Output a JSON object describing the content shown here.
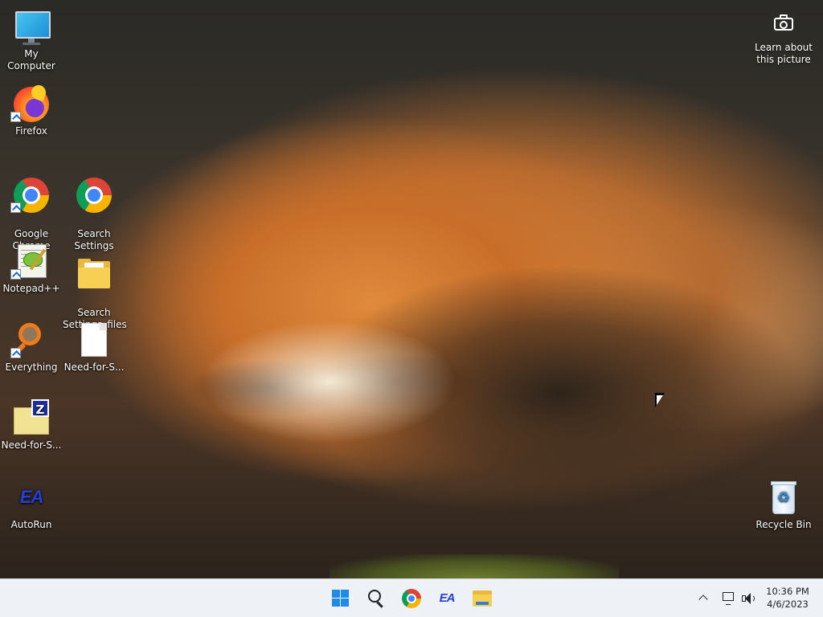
{
  "desktop": {
    "icons": [
      {
        "label": "My Computer",
        "icon": "monitor-icon"
      },
      {
        "label": "Firefox",
        "icon": "firefox-icon",
        "shortcut": true
      },
      {
        "label": "Google\nChrome",
        "icon": "chrome-icon",
        "shortcut": true
      },
      {
        "label": "Search\nSettings",
        "icon": "chrome-icon"
      },
      {
        "label": "Notepad++",
        "icon": "notepadpp-icon",
        "shortcut": true
      },
      {
        "label": "Search\nSettings_files",
        "icon": "folder-icon"
      },
      {
        "label": "Everything",
        "icon": "everything-icon",
        "shortcut": true
      },
      {
        "label": "Need-for-S...",
        "icon": "file-icon"
      },
      {
        "label": "Need-for-S...",
        "icon": "zip-folder-icon"
      },
      {
        "label": "AutoRun",
        "icon": "ea-icon"
      },
      {
        "label": "Recycle Bin",
        "icon": "recycle-bin-icon"
      }
    ],
    "learn_about": {
      "line1": "Learn about",
      "line2": "this picture",
      "icon": "camera-icon"
    }
  },
  "taskbar": {
    "pinned": [
      {
        "name": "start",
        "icon": "windows-logo-icon"
      },
      {
        "name": "search",
        "icon": "search-icon"
      },
      {
        "name": "chrome",
        "icon": "chrome-icon"
      },
      {
        "name": "ea",
        "icon": "ea-icon",
        "text": "EA"
      },
      {
        "name": "file-explorer",
        "icon": "folder-icon"
      }
    ],
    "tray": {
      "icons": [
        "chevron-up-icon",
        "network-icon",
        "volume-icon"
      ],
      "time": "10:36 PM",
      "date": "4/6/2023"
    }
  },
  "colors": {
    "taskbar_bg": "#eef2f6",
    "accent": "#1f8be8"
  }
}
